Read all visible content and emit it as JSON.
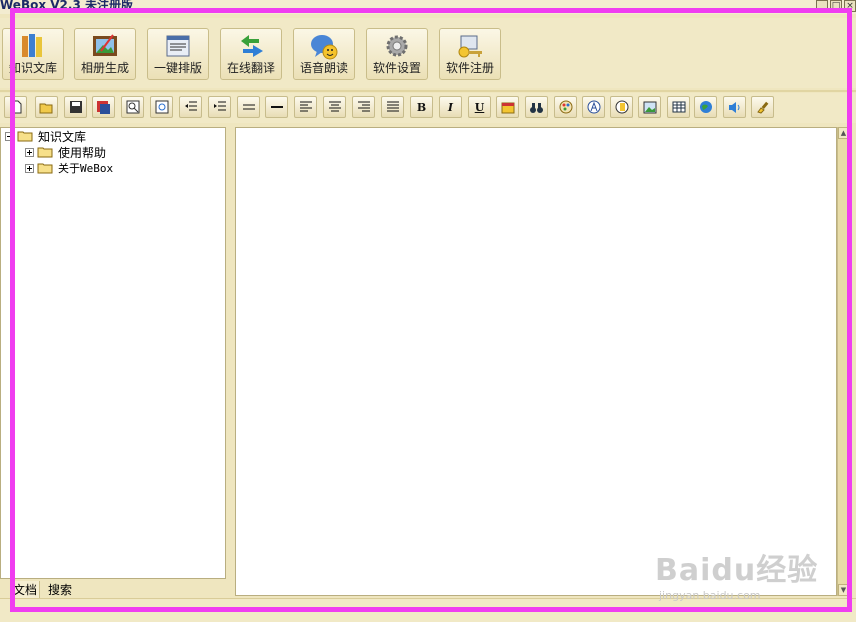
{
  "window": {
    "title": "WeBox V2.3 未注册版"
  },
  "main_toolbar": [
    {
      "label": "知识文库",
      "icon": "books-icon"
    },
    {
      "label": "相册生成",
      "icon": "painting-icon"
    },
    {
      "label": "一键排版",
      "icon": "layout-icon"
    },
    {
      "label": "在线翻译",
      "icon": "translate-arrows-icon"
    },
    {
      "label": "语音朗读",
      "icon": "speech-icon"
    },
    {
      "label": "软件设置",
      "icon": "gear-icon"
    },
    {
      "label": "软件注册",
      "icon": "register-key-icon"
    }
  ],
  "format_toolbar": {
    "bold": "B",
    "italic": "I",
    "underline": "U"
  },
  "tree": {
    "root": "知识文库",
    "children": [
      "使用帮助",
      "关于WeBox"
    ]
  },
  "tabs": [
    "文档",
    "搜索"
  ],
  "watermark": {
    "brand": "Baidu经验",
    "url": "jingyan.baidu.com"
  },
  "colors": {
    "highlight": "#f03df0",
    "chrome": "#f1e9c6"
  }
}
